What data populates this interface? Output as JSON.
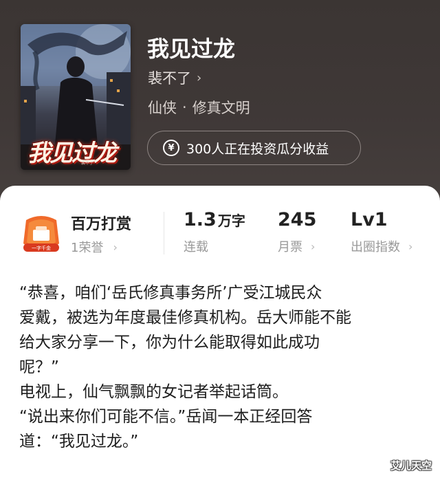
{
  "book": {
    "title": "我见过龙",
    "author": "裴不了",
    "author_chevron": "›",
    "genre_primary": "仙侠",
    "genre_separator": "·",
    "genre_secondary": "修真文明",
    "invest_text": "300人正在投资瓜分收益",
    "invest_icon": "yen-icon",
    "invest_symbol": "¥"
  },
  "cover": {
    "title_art": "我见过龙",
    "author_small": "裴不了"
  },
  "stats": {
    "reward": {
      "title": "百万打赏",
      "subtitle": "1荣誉",
      "chevron": "›",
      "badge_text": "一字千金"
    },
    "words": {
      "value": "1.3",
      "unit": "万字",
      "label": "连载"
    },
    "tickets": {
      "value": "245",
      "label": "月票",
      "chevron": "›"
    },
    "level": {
      "value": "Lv1",
      "label": "出圈指数",
      "chevron": "›"
    }
  },
  "content": {
    "lines": [
      "“恭喜，咱们‘岳氏修真事务所’广受江城民众",
      "爱戴，被选为年度最佳修真机构。岳大师能不能",
      "给大家分享一下，你为什么能取得如此成功",
      "呢？”",
      "电视上，仙气飘飘的女记者举起话筒。",
      "“说出来你们可能不信。”岳闻一本正经回答",
      "道：“我见过龙。”"
    ]
  },
  "watermark": "艾儿天空",
  "colors": {
    "header_bg": "#3f3837",
    "card_bg": "#ffffff",
    "badge_orange": "#f06a2a",
    "badge_red": "#d93a1f"
  }
}
